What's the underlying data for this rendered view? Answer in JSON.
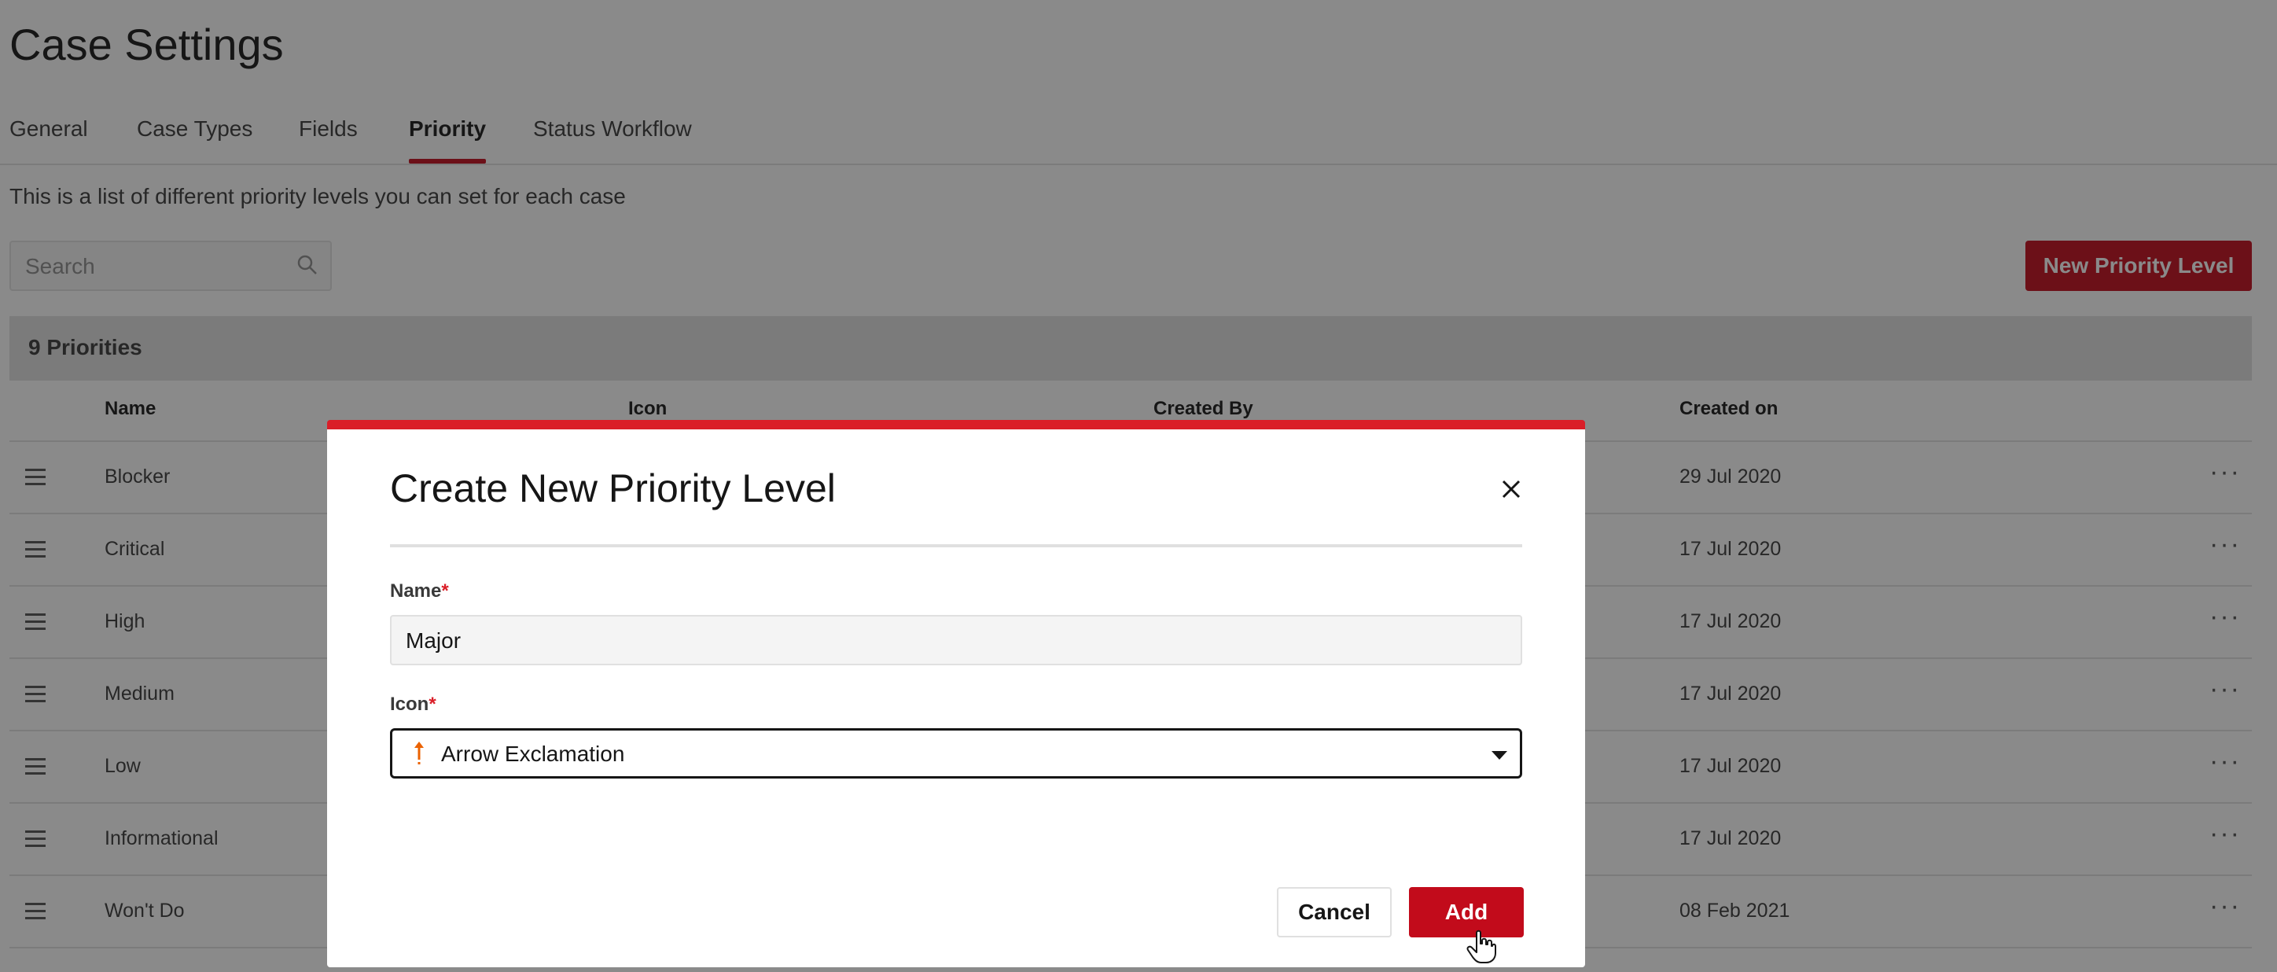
{
  "page": {
    "title": "Case Settings",
    "description": "This is a list of different priority levels you can set for each case"
  },
  "tabs": [
    {
      "label": "General"
    },
    {
      "label": "Case Types"
    },
    {
      "label": "Fields"
    },
    {
      "label": "Priority",
      "active": true
    },
    {
      "label": "Status Workflow"
    }
  ],
  "search": {
    "placeholder": "Search"
  },
  "toolbar": {
    "new_label": "New Priority Level"
  },
  "table": {
    "count_label": "9 Priorities",
    "columns": [
      "Name",
      "Icon",
      "Created By",
      "Created on"
    ],
    "rows": [
      {
        "name": "Blocker",
        "created_on": "29 Jul 2020"
      },
      {
        "name": "Critical",
        "created_on": "17 Jul 2020"
      },
      {
        "name": "High",
        "created_on": "17 Jul 2020"
      },
      {
        "name": "Medium",
        "created_on": "17 Jul 2020"
      },
      {
        "name": "Low",
        "created_on": "17 Jul 2020"
      },
      {
        "name": "Informational",
        "created_on": "17 Jul 2020"
      },
      {
        "name": "Won't Do",
        "created_on": "08 Feb 2021"
      }
    ]
  },
  "modal": {
    "title": "Create New Priority Level",
    "name_label": "Name",
    "name_value": "Major",
    "icon_label": "Icon",
    "icon_value": "Arrow Exclamation",
    "icon_name": "arrow-exclamation-icon",
    "required_mark": "*",
    "cancel_label": "Cancel",
    "add_label": "Add"
  },
  "colors": {
    "accent": "#c20b1b",
    "required": "#da1e28",
    "icon_orange": "#eb6200"
  }
}
